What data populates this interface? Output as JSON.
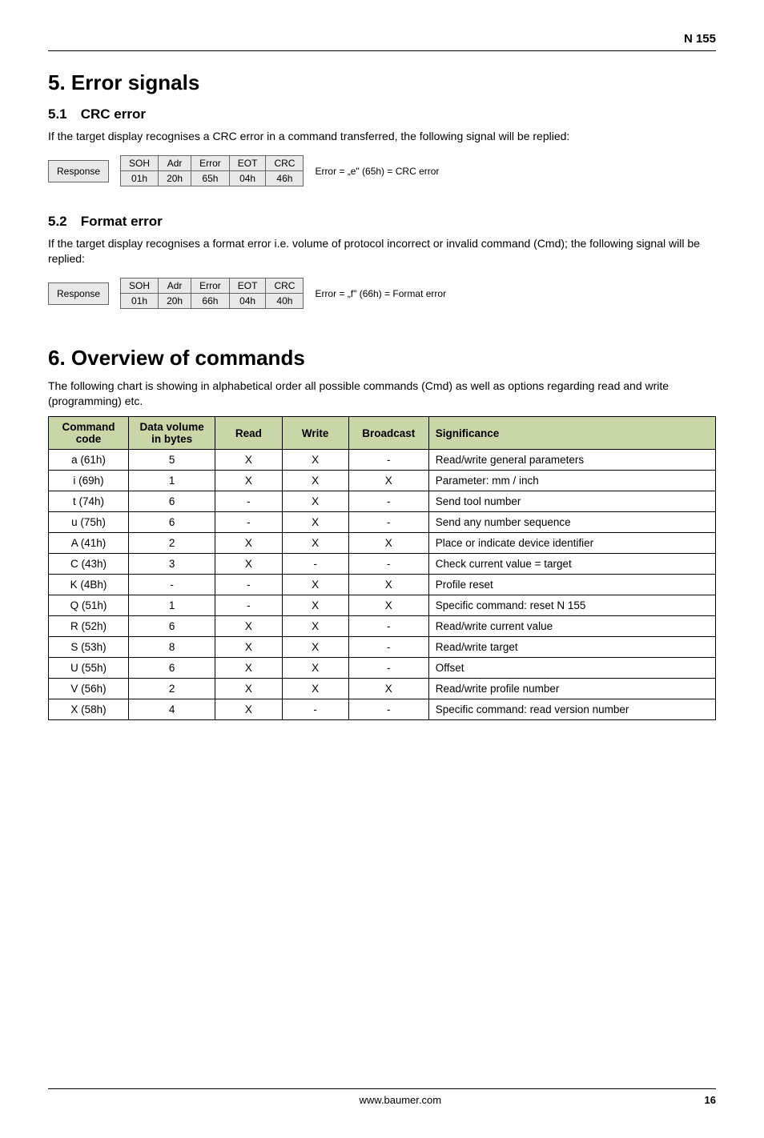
{
  "header": {
    "doc_code": "N 155"
  },
  "section5": {
    "title": "5. Error signals",
    "s51": {
      "heading_num": "5.1",
      "heading": "CRC error",
      "intro": "If the target display recognises a CRC error in a command transferred, the following signal will be replied:",
      "resp_label": "Response",
      "cols": [
        "SOH",
        "Adr",
        "Error",
        "EOT",
        "CRC"
      ],
      "vals": [
        "01h",
        "20h",
        "65h",
        "04h",
        "46h"
      ],
      "note": "Error = „e\" (65h) = CRC error"
    },
    "s52": {
      "heading_num": "5.2",
      "heading": "Format error",
      "intro": "If the target display recognises a format error i.e. volume of protocol incorrect or invalid command (Cmd); the following signal will be replied:",
      "resp_label": "Response",
      "cols": [
        "SOH",
        "Adr",
        "Error",
        "EOT",
        "CRC"
      ],
      "vals": [
        "01h",
        "20h",
        "66h",
        "04h",
        "40h"
      ],
      "note": "Error = „f\" (66h)  = Format error"
    }
  },
  "section6": {
    "title": "6. Overview of commands",
    "intro": "The following chart is showing in alphabetical order all possible commands (Cmd) as well as options regarding read and write (programming) etc.",
    "headers": {
      "cmd": "Command code",
      "dv": "Data volume in bytes",
      "read": "Read",
      "write": "Write",
      "bcast": "Broadcast",
      "sig": "Significance"
    },
    "rows": [
      {
        "cmd": "a  (61h)",
        "dv": "5",
        "r": "X",
        "w": "X",
        "b": "-",
        "sig": "Read/write general parameters"
      },
      {
        "cmd": "i  (69h)",
        "dv": "1",
        "r": "X",
        "w": "X",
        "b": "X",
        "sig": "Parameter: mm / inch"
      },
      {
        "cmd": "t  (74h)",
        "dv": "6",
        "r": "-",
        "w": "X",
        "b": "-",
        "sig": "Send tool number"
      },
      {
        "cmd": "u  (75h)",
        "dv": "6",
        "r": "-",
        "w": "X",
        "b": "-",
        "sig": "Send any number sequence"
      },
      {
        "cmd": "A  (41h)",
        "dv": "2",
        "r": "X",
        "w": "X",
        "b": "X",
        "sig": "Place or indicate device identifier"
      },
      {
        "cmd": "C  (43h)",
        "dv": "3",
        "r": "X",
        "w": "-",
        "b": "-",
        "sig": "Check current value = target"
      },
      {
        "cmd": "K  (4Bh)",
        "dv": "-",
        "r": "-",
        "w": "X",
        "b": "X",
        "sig": "Profile reset"
      },
      {
        "cmd": "Q  (51h)",
        "dv": "1",
        "r": "-",
        "w": "X",
        "b": "X",
        "sig": "Specific command: reset N 155"
      },
      {
        "cmd": "R  (52h)",
        "dv": "6",
        "r": "X",
        "w": "X",
        "b": "-",
        "sig": "Read/write current value"
      },
      {
        "cmd": "S  (53h)",
        "dv": "8",
        "r": "X",
        "w": "X",
        "b": "-",
        "sig": "Read/write target"
      },
      {
        "cmd": "U  (55h)",
        "dv": "6",
        "r": "X",
        "w": "X",
        "b": "-",
        "sig": "Offset"
      },
      {
        "cmd": "V  (56h)",
        "dv": "2",
        "r": "X",
        "w": "X",
        "b": "X",
        "sig": "Read/write profile number"
      },
      {
        "cmd": "X  (58h)",
        "dv": "4",
        "r": "X",
        "w": "-",
        "b": "-",
        "sig": "Specific command: read version number"
      }
    ]
  },
  "footer": {
    "site": "www.baumer.com",
    "page": "16"
  }
}
